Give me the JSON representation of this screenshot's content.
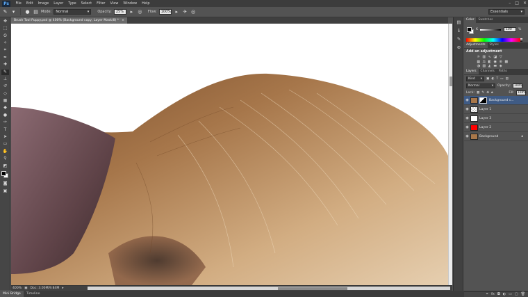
{
  "menubar": {
    "logo": "Ps",
    "items": [
      "File",
      "Edit",
      "Image",
      "Layer",
      "Type",
      "Select",
      "Filter",
      "View",
      "Window",
      "Help"
    ],
    "window_controls": [
      "–",
      "□",
      "✕"
    ]
  },
  "options": {
    "mode_label": "Mode:",
    "mode_value": "Normal",
    "opacity_label": "Opacity:",
    "opacity_value": "25%",
    "flow_label": "Flow:",
    "flow_value": "100%",
    "workspace": "Essentials"
  },
  "document": {
    "tab_title": "Brush Tool Puppy.psd @ 400% (Background copy, Layer Mask/8) *",
    "tab_close": "×",
    "zoom": "400%",
    "doc_size": "Doc: 3.00M/9.84M"
  },
  "bottom_tabs": [
    "Mini Bridge",
    "Timeline"
  ],
  "panels": {
    "color_tabs": [
      "Color",
      "Swatches"
    ],
    "color_channel": "K",
    "color_value": "100",
    "color_unit": "%",
    "adjust_tabs": [
      "Adjustments",
      "Styles"
    ],
    "adjust_title": "Add an adjustment",
    "layers_tabs": [
      "Layers",
      "Channels",
      "Paths"
    ],
    "kind_filter": "Kind",
    "blend_mode": "Normal",
    "opacity_label": "Opacity:",
    "opacity_value": "100%",
    "lock_label": "Lock:",
    "fill_label": "Fill:",
    "fill_value": "100%",
    "layers": [
      {
        "name": "Background c...",
        "thumb": "#a8774a",
        "mask": true,
        "selected": true
      },
      {
        "name": "Layer 1",
        "thumb": "#c9c9c9",
        "mask": false,
        "selected": false
      },
      {
        "name": "Layer 3",
        "thumb": "#ffffff",
        "mask": false,
        "selected": false
      },
      {
        "name": "Layer 2",
        "thumb": "#ff0000",
        "mask": false,
        "selected": false
      },
      {
        "name": "Background",
        "thumb": "#a8774a",
        "mask": false,
        "selected": false
      }
    ]
  },
  "colors": {
    "selection": "#3f5b85",
    "fur": "#c49a6c"
  }
}
